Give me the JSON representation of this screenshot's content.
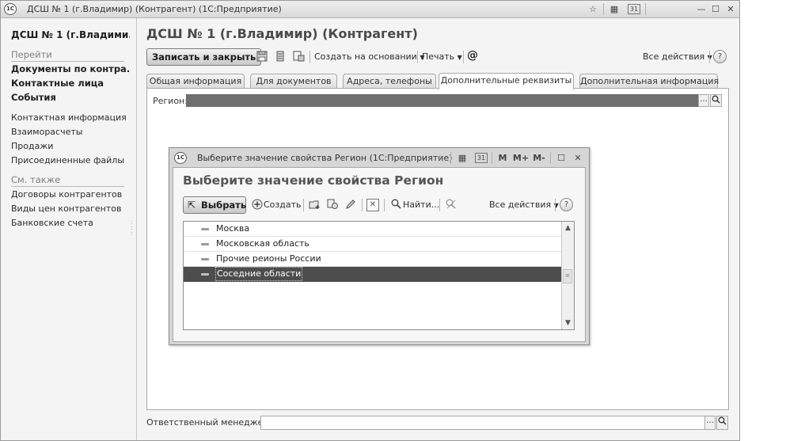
{
  "window": {
    "title": "ДСШ № 1 (г.Владимир) (Контрагент)  (1С:Предприятие)",
    "logo_text": "1С",
    "title_buttons": {
      "favorite": "☆",
      "calculator": "▦",
      "calendar": "31",
      "minimize": "—",
      "maximize": "☐",
      "close": "✕"
    }
  },
  "nav": {
    "title": "ДСШ № 1 (г.Владими...",
    "goto_section": "Перейти",
    "main_links": [
      "Документы по контра...",
      "Контактные лица",
      "События"
    ],
    "links": [
      "Контактная информация",
      "Взаиморасчеты",
      "Продажи",
      "Присоединенные файлы"
    ],
    "see_also_section": "См. также",
    "see_also_links": [
      "Договоры контрагентов",
      "Виды цен контрагентов",
      "Банковские счета"
    ]
  },
  "form": {
    "title": "ДСШ № 1 (г.Владимир) (Контрагент)",
    "toolbar": {
      "save_close_label": "Записать и закрыть",
      "create_based_label": "Создать на основании",
      "print_label": "Печать",
      "at_label": "@",
      "all_actions_label": "Все действия",
      "help_label": "?"
    },
    "tabs": [
      {
        "label": "Общая информация",
        "active": false
      },
      {
        "label": "Для документов",
        "active": false
      },
      {
        "label": "Адреса, телефоны",
        "active": false
      },
      {
        "label": "Дополнительные реквизиты",
        "active": true
      },
      {
        "label": "Дополнительная информация",
        "active": false
      }
    ],
    "region_label": "Регион:",
    "region_value": "",
    "manager_label": "Ответственный менеджер:",
    "manager_value": "",
    "ellipsis": "...",
    "search_glyph": "⚲"
  },
  "dialog": {
    "title": "Выберите значение свойства Регион  (1С:Предприятие)",
    "logo_text": "1С",
    "title_buttons": {
      "favorite": "☆",
      "calculator": "▦",
      "calendar": "31",
      "mem": "M",
      "mem_plus": "M+",
      "mem_minus": "M-",
      "maximize": "☐",
      "close": "✕"
    },
    "form_title": "Выберите значение свойства Регион",
    "toolbar": {
      "select_label": "Выбрать",
      "create_label": "Создать",
      "find_label": "Найти...",
      "all_actions_label": "Все действия",
      "help_label": "?"
    },
    "list_items": [
      {
        "label": "Москва",
        "selected": false
      },
      {
        "label": "Московская область",
        "selected": false
      },
      {
        "label": "Прочие реионы России",
        "selected": false
      },
      {
        "label": "Соседние области",
        "selected": true
      }
    ]
  },
  "colors": {
    "selection": "#4d4d4d",
    "window_bg": "#f4f4f4",
    "field_filled": "#6f6f6f"
  }
}
